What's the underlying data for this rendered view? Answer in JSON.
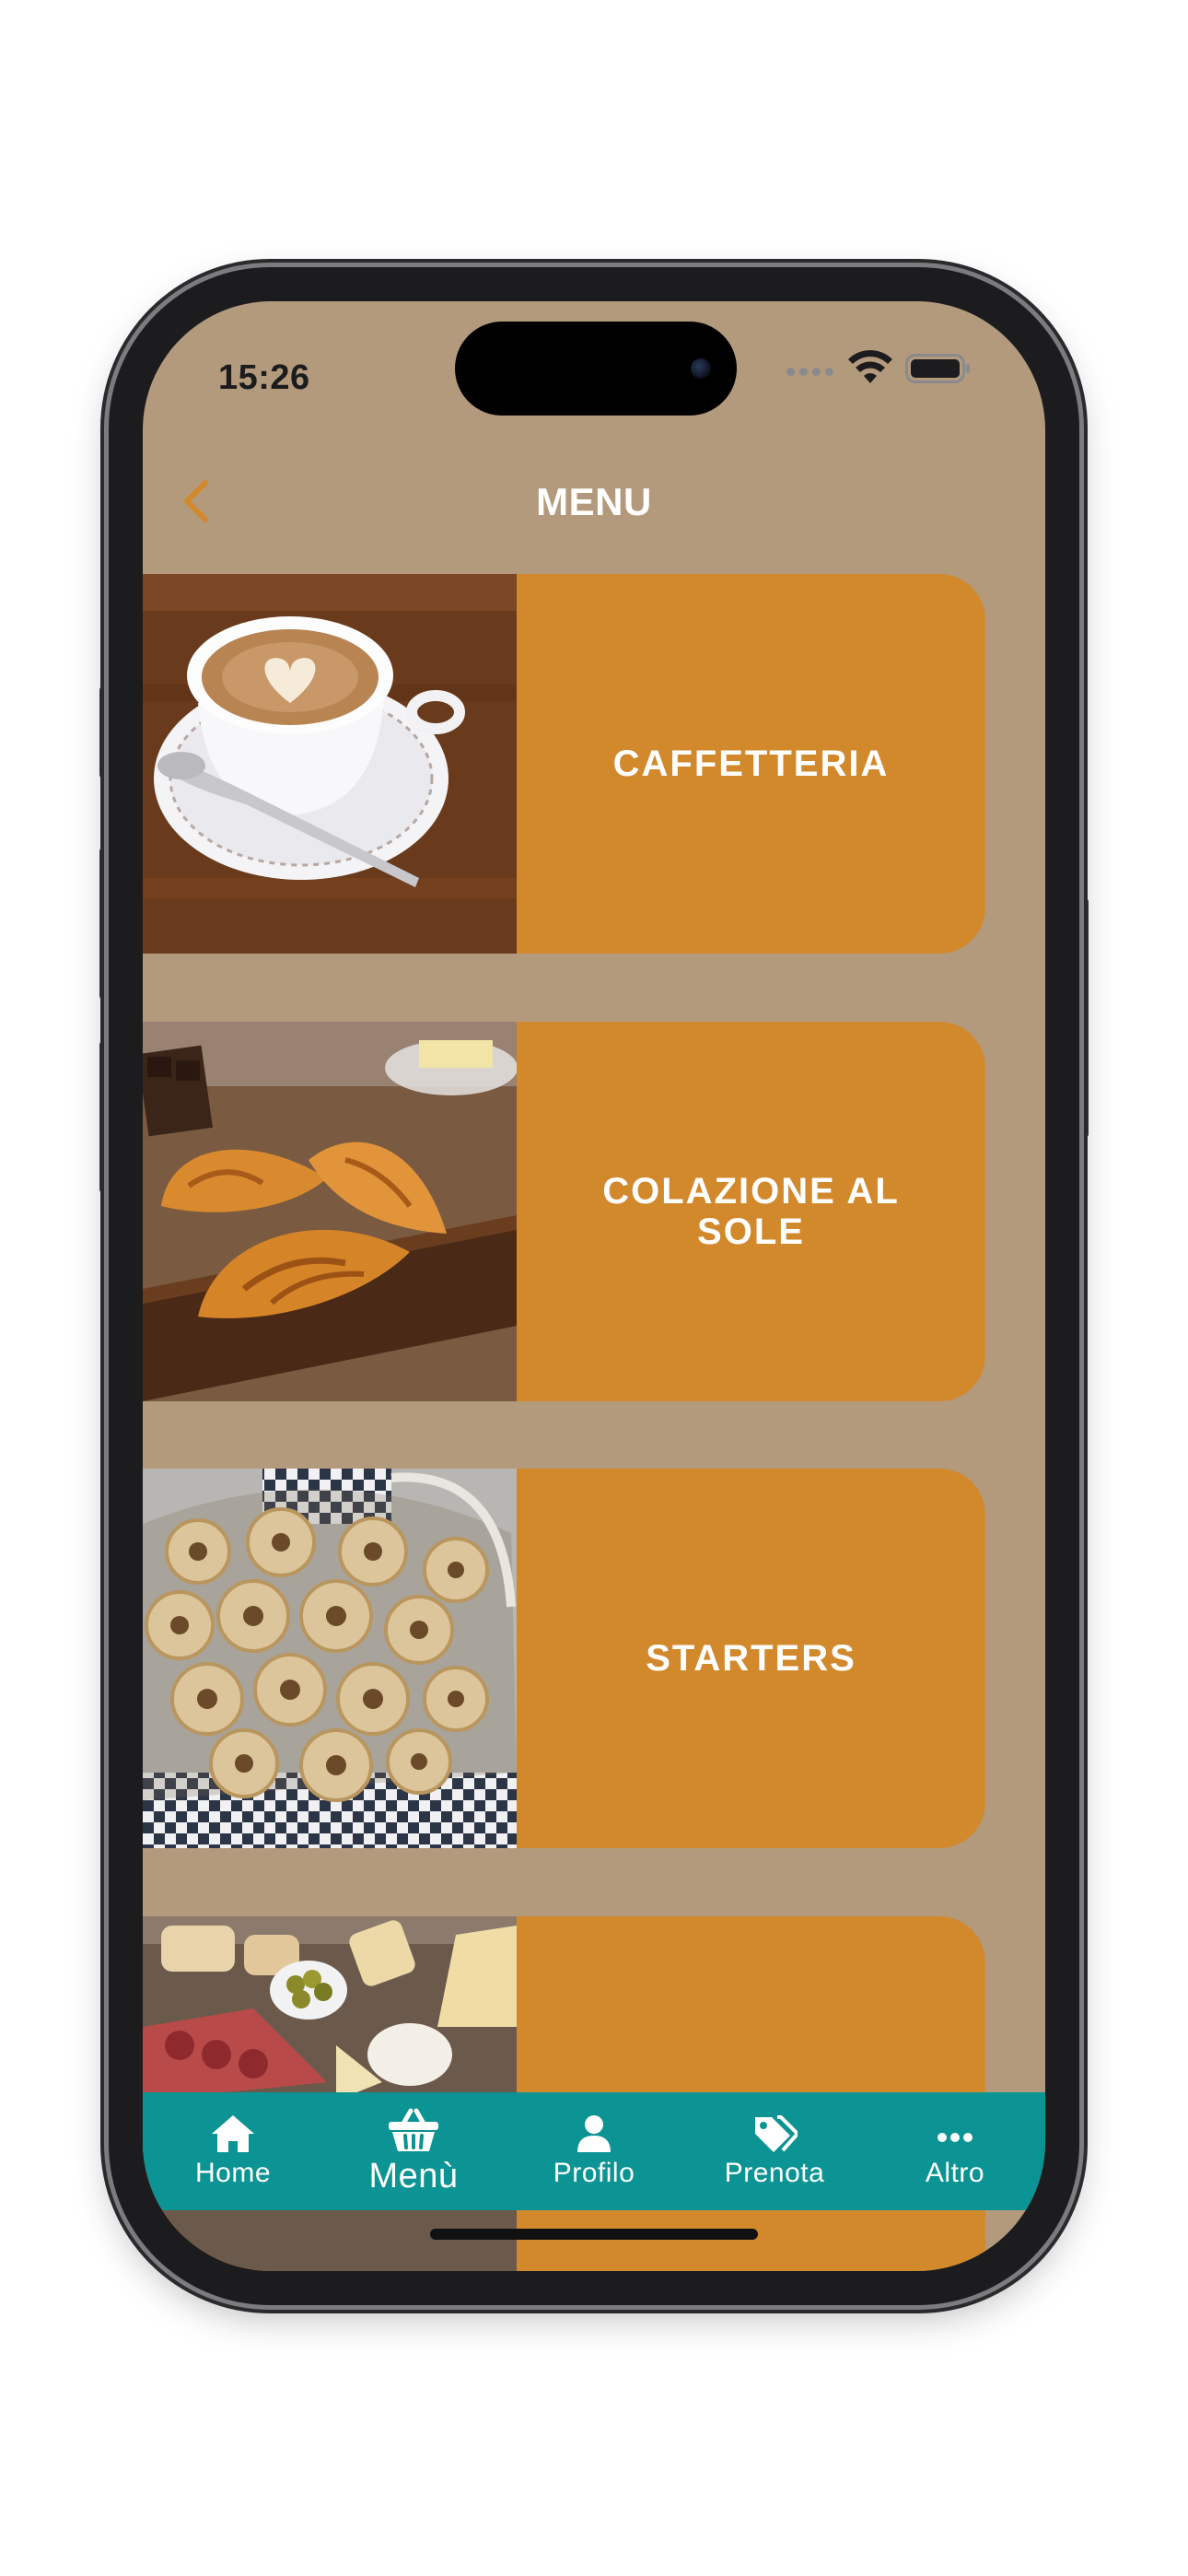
{
  "status_bar": {
    "time": "15:26"
  },
  "header": {
    "title": "MENU",
    "back_icon": "chevron-left-icon"
  },
  "menu": {
    "categories": [
      {
        "label": "CAFFETTERIA",
        "image": "cappuccino-photo"
      },
      {
        "label": "COLAZIONE AL SOLE",
        "image": "croissants-photo"
      },
      {
        "label": "STARTERS",
        "image": "taralli-photo"
      },
      {
        "label": "",
        "image": "charcuterie-board-photo"
      }
    ]
  },
  "tab_bar": {
    "items": [
      {
        "label": "Home",
        "icon": "home-icon"
      },
      {
        "label": "Menù",
        "icon": "basket-icon"
      },
      {
        "label": "Profilo",
        "icon": "person-icon"
      },
      {
        "label": "Prenota",
        "icon": "tags-icon"
      },
      {
        "label": "Altro",
        "icon": "more-dots-icon"
      }
    ]
  },
  "colors": {
    "screen_background": "#b39a7c",
    "card_background": "#d1892c",
    "tab_bar_background": "#0c9393",
    "back_arrow": "#d1892c",
    "title_text": "#ffffff"
  }
}
